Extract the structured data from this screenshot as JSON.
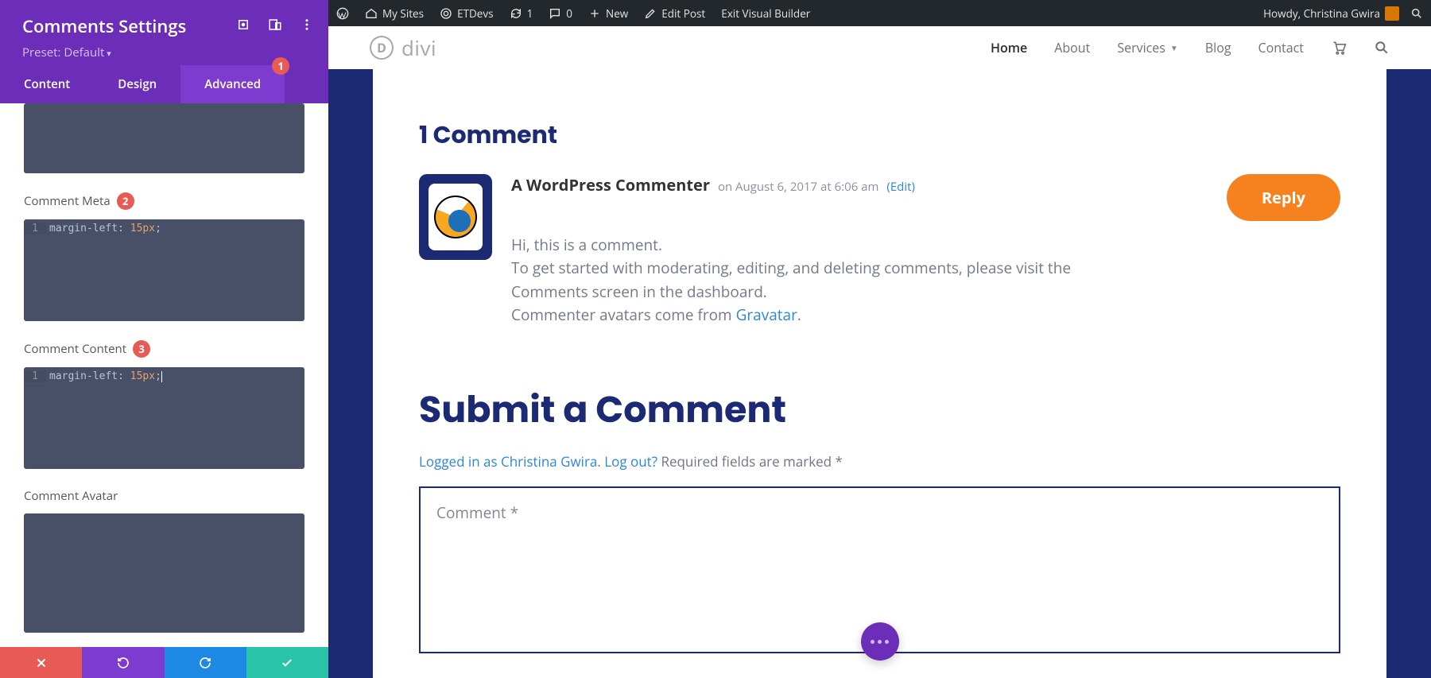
{
  "sidebar": {
    "title": "Comments Settings",
    "preset": "Preset: Default",
    "tabs": {
      "content": "Content",
      "design": "Design",
      "advanced": "Advanced"
    },
    "badge1": "1",
    "fields": {
      "meta": {
        "label": "Comment Meta",
        "badge": "2",
        "code": {
          "line": "1",
          "prop": "margin-left:",
          "val": "15px"
        }
      },
      "content": {
        "label": "Comment Content",
        "badge": "3",
        "code": {
          "line": "1",
          "prop": "margin-left:",
          "val": "15px"
        }
      },
      "avatar": {
        "label": "Comment Avatar"
      }
    }
  },
  "wpbar": {
    "my_sites": "My Sites",
    "site": "ETDevs",
    "updates": "1",
    "comments": "0",
    "new": "New",
    "edit_post": "Edit Post",
    "exit_vb": "Exit Visual Builder",
    "howdy": "Howdy, Christina Gwira"
  },
  "nav": {
    "logo_letter": "D",
    "logo_word": "divi",
    "home": "Home",
    "about": "About",
    "services": "Services",
    "blog": "Blog",
    "contact": "Contact"
  },
  "comments": {
    "heading": "1 Comment",
    "author": "A WordPress Commenter",
    "date": "on August 6, 2017 at 6:06 am",
    "edit": "(Edit)",
    "reply": "Reply",
    "body_l1": "Hi, this is a comment.",
    "body_l2": "To get started with moderating, editing, and deleting comments, please visit the Comments screen in the dashboard.",
    "body_l3a": "Commenter avatars come from ",
    "body_l3link": "Gravatar",
    "body_l3b": "."
  },
  "submit": {
    "heading": "Submit a Comment",
    "logged_in": "Logged in as Christina Gwira",
    "logout": "Log out?",
    "required": " Required fields are marked *",
    "placeholder": "Comment *"
  }
}
